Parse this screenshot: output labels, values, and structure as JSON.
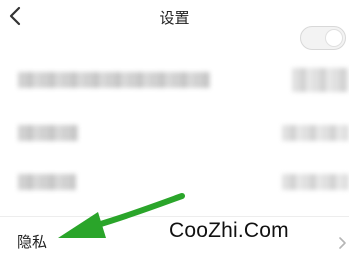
{
  "header": {
    "title": "设置",
    "back_icon": "chevron-left-icon"
  },
  "rows": {
    "privacy": {
      "label": "隐私",
      "chevron_icon": "chevron-right-icon"
    }
  },
  "overlay": {
    "watermark_text": "CooZhi.Com",
    "arrow_color": "#2aa52a"
  }
}
